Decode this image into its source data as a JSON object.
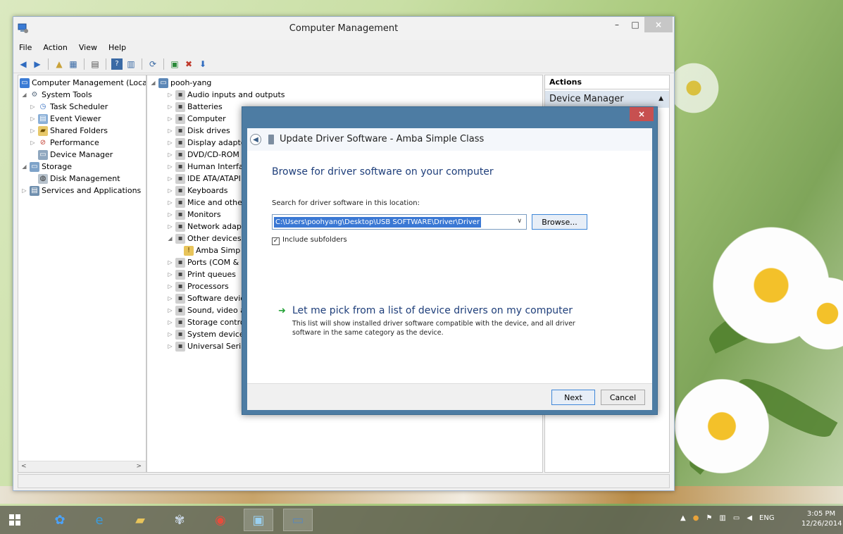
{
  "window": {
    "title": "Computer Management",
    "minimize": "–",
    "maximize": "□",
    "close": "×"
  },
  "menu": [
    "File",
    "Action",
    "View",
    "Help"
  ],
  "left_tree": [
    {
      "label": "Computer Management (Local",
      "icon": "computer-management-icon",
      "arrow": ""
    },
    {
      "label": "System Tools",
      "icon": "system-tools-icon",
      "arrow": "◢"
    },
    {
      "label": "Task Scheduler",
      "icon": "clock-icon",
      "arrow": "▷"
    },
    {
      "label": "Event Viewer",
      "icon": "event-viewer-icon",
      "arrow": "▷"
    },
    {
      "label": "Shared Folders",
      "icon": "shared-folder-icon",
      "arrow": "▷"
    },
    {
      "label": "Performance",
      "icon": "performance-icon",
      "arrow": "▷"
    },
    {
      "label": "Device Manager",
      "icon": "device-manager-icon",
      "arrow": ""
    },
    {
      "label": "Storage",
      "icon": "storage-icon",
      "arrow": "◢"
    },
    {
      "label": "Disk Management",
      "icon": "disk-management-icon",
      "arrow": ""
    },
    {
      "label": "Services and Applications",
      "icon": "services-icon",
      "arrow": "▷"
    }
  ],
  "device_tree": {
    "root": "pooh-yang",
    "items": [
      {
        "label": "Audio inputs and outputs",
        "arrow": "▷"
      },
      {
        "label": "Batteries",
        "arrow": "▷"
      },
      {
        "label": "Computer",
        "arrow": "▷"
      },
      {
        "label": "Disk drives",
        "arrow": "▷"
      },
      {
        "label": "Display adapter",
        "arrow": "▷"
      },
      {
        "label": "DVD/CD-ROM d",
        "arrow": "▷"
      },
      {
        "label": "Human Interfac",
        "arrow": "▷"
      },
      {
        "label": "IDE ATA/ATAPI",
        "arrow": "▷"
      },
      {
        "label": "Keyboards",
        "arrow": "▷"
      },
      {
        "label": "Mice and other",
        "arrow": "▷"
      },
      {
        "label": "Monitors",
        "arrow": "▷"
      },
      {
        "label": "Network adapte",
        "arrow": "▷"
      },
      {
        "label": "Other devices",
        "arrow": "◢"
      },
      {
        "label": "Amba Simp",
        "arrow": "",
        "child": true
      },
      {
        "label": "Ports (COM & L",
        "arrow": "▷"
      },
      {
        "label": "Print queues",
        "arrow": "▷"
      },
      {
        "label": "Processors",
        "arrow": "▷"
      },
      {
        "label": "Software device",
        "arrow": "▷"
      },
      {
        "label": "Sound, video ar",
        "arrow": "▷"
      },
      {
        "label": "Storage control",
        "arrow": "▷"
      },
      {
        "label": "System devices",
        "arrow": "▷"
      },
      {
        "label": "Universal Serial",
        "arrow": "▷"
      }
    ]
  },
  "actions": {
    "header": "Actions",
    "section": "Device Manager"
  },
  "dialog": {
    "title": "Update Driver Software - Amba Simple Class",
    "close": "×",
    "heading": "Browse for driver software on your computer",
    "search_label": "Search for driver software in this location:",
    "path": "C:\\Users\\poohyang\\Desktop\\USB SOFTWARE\\Driver\\Driver",
    "browse": "Browse...",
    "include_subfolders": "Include subfolders",
    "include_checked": true,
    "pick_link": "Let me pick from a list of device drivers on my computer",
    "pick_desc": "This list will show installed driver software compatible with the device, and all driver software in the same category as the device.",
    "next": "Next",
    "cancel": "Cancel"
  },
  "taskbar": {
    "language": "ENG",
    "time": "3:05 PM",
    "date": "12/26/2014"
  },
  "colors": {
    "dialog_frame": "#4d7ca3",
    "link": "#1e3e7a",
    "selection": "#3a78d4",
    "close_red": "#c75050"
  }
}
